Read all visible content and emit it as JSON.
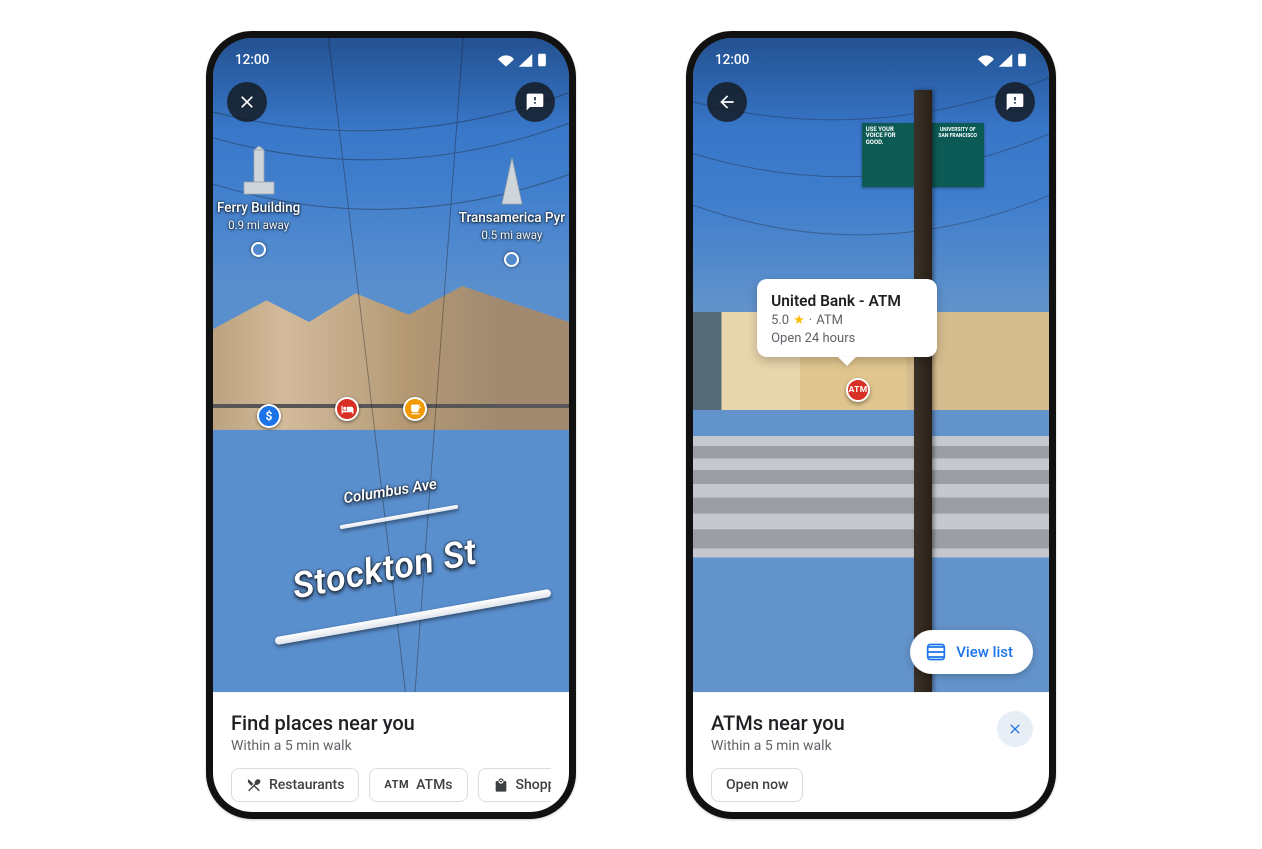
{
  "status_bar": {
    "time": "12:00"
  },
  "phone1": {
    "top_left_icon": "close-icon",
    "top_right_icon": "feedback-icon",
    "landmarks": [
      {
        "name": "Ferry Building",
        "distance": "0.9 mi away"
      },
      {
        "name": "Transamerica Pyr",
        "distance": "0.5 mi away"
      }
    ],
    "poi_pins": [
      {
        "kind": "money"
      },
      {
        "kind": "hotel"
      },
      {
        "kind": "cafe"
      }
    ],
    "streets": {
      "columbus": "Columbus Ave",
      "stockton": "Stockton St"
    },
    "sheet": {
      "title": "Find places near you",
      "subtitle": "Within a 5 min walk",
      "chips": [
        {
          "icon": "restaurant",
          "label": "Restaurants"
        },
        {
          "icon": "atm",
          "label": "ATMs"
        },
        {
          "icon": "shopping",
          "label": "Shopping"
        }
      ]
    }
  },
  "phone2": {
    "top_left_icon": "back-icon",
    "top_right_icon": "feedback-icon",
    "banner_left_text": "USE YOUR VOICE FOR GOOD.",
    "banner_right_text": "UNIVERSITY OF SAN FRANCISCO",
    "callout": {
      "title": "United Bank - ATM",
      "rating": "5.0",
      "category": "ATM",
      "hours": "Open 24 hours"
    },
    "atm_pin_label": "ATM",
    "view_list_label": "View list",
    "sheet": {
      "title": "ATMs near you",
      "subtitle": "Within a 5 min walk",
      "chips": [
        {
          "label": "Open now"
        }
      ]
    }
  }
}
